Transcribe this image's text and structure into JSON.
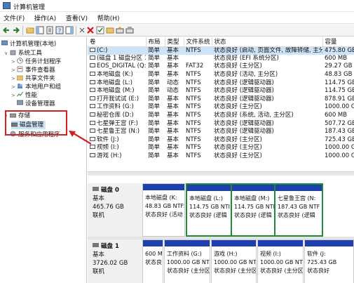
{
  "window": {
    "title": "计算机管理"
  },
  "menu": [
    "文件(F)",
    "操作(A)",
    "查看(V)",
    "帮助(H)"
  ],
  "tree": {
    "root": "计算机管理(本地)",
    "system_tools": "系统工具",
    "task_scheduler": "任务计划程序",
    "event_viewer": "事件查看器",
    "shared_folders": "共享文件夹",
    "local_users": "本地用户和组",
    "performance": "性能",
    "device_manager": "设备管理器",
    "storage": "存储",
    "disk_management": "磁盘管理",
    "services": "服务和应用程序"
  },
  "table": {
    "columns": [
      "卷",
      "布局",
      "类型",
      "文件系统",
      "状态",
      "容量"
    ],
    "rows": [
      [
        "(C:)",
        "简单",
        "基本",
        "NTFS",
        "状态良好 (启动, 页面文件, 故障转储, 主分区)",
        "475.80 GB"
      ],
      [
        "(磁盘 1 磁盘分区 1)",
        "简单",
        "基本",
        "",
        "状态良好 (EFI 系统分区)",
        "600 MB"
      ],
      [
        "EOS_DIGITAL (Q:)",
        "简单",
        "基本",
        "FAT32",
        "状态良好 (主分区)",
        "29.27 GB"
      ],
      [
        "本地磁盘 (K:)",
        "简单",
        "基本",
        "NTFS",
        "状态良好 (活动, 主分区)",
        "48.83 GB"
      ],
      [
        "本地磁盘 (L:)",
        "简单",
        "动态",
        "NTFS",
        "状态良好 (逻辑驱动器)",
        "114.75 GB"
      ],
      [
        "本地磁盘 (M:)",
        "简单",
        "动态",
        "NTFS",
        "状态良好 (逻辑驱动器)",
        "114.75 GB"
      ],
      [
        "打开我试试 (E:)",
        "简单",
        "基本",
        "NTFS",
        "状态良好 (逻辑驱动器)",
        "878.91 GB"
      ],
      [
        "工作资料 (G:)",
        "简单",
        "基本",
        "NTFS",
        "状态良好 (主分区)",
        "1000.00 GB"
      ],
      [
        "秘密仓库 (D:)",
        "简单",
        "基本",
        "NTFS",
        "状态良好 (系统, 活动, 主分区)",
        "600 MB"
      ],
      [
        "七星弹王宫 (F:)",
        "简单",
        "基本",
        "NTFS",
        "状态良好 (逻辑驱动器)",
        "507.72 GB"
      ],
      [
        "七星鲁王宫 (N:)",
        "简单",
        "基本",
        "NTFS",
        "状态良好 (逻辑驱动器)",
        "187.43 GB"
      ],
      [
        "软件 (J:)",
        "简单",
        "基本",
        "NTFS",
        "状态良好 (主分区)",
        "725.43 GB"
      ],
      [
        "视频 (I:)",
        "简单",
        "基本",
        "NTFS",
        "状态良好 (主分区)",
        "1000.00 GB"
      ],
      [
        "游戏 (H:)",
        "简单",
        "基本",
        "NTFS",
        "状态良好 (主分区)",
        "1000.00 GB"
      ]
    ]
  },
  "disk0": {
    "name": "磁盘 0",
    "type": "基本",
    "size": "465.76 GB",
    "status": "联机",
    "partitions": [
      {
        "name": "本地磁盘 (K:",
        "size": "48.83 GB NTFS",
        "status": "状态良好 (活动"
      },
      {
        "name": "本地磁盘 (L:)",
        "size": "114.75 GB NTI",
        "status": "状态良好 (逻辑"
      },
      {
        "name": "本地磁盘 (M:)",
        "size": "114.75 GB NTI",
        "status": "状态良好 (逻辑"
      },
      {
        "name": "七星鲁王宫 (N:",
        "size": "187.43 GB NTF",
        "status": "状态良好 (逻辑"
      }
    ]
  },
  "disk1": {
    "name": "磁盘 1",
    "type": "基本",
    "size": "3726.02 GB",
    "status": "联机",
    "partitions": [
      {
        "name": "",
        "size": "600 M",
        "status": "状态良"
      },
      {
        "name": "工作资料 (G:)",
        "size": "1000.00 GB NTFS",
        "status": "状态良好 (主分区"
      },
      {
        "name": "游戏 (H:)",
        "size": "1000.00 GB NTFS",
        "status": "状态良好 (主分区"
      },
      {
        "name": "视频 (I:)",
        "size": "1000.00 GB NTFS",
        "status": "状态良好 (主分区"
      },
      {
        "name": "软件 (J:",
        "size": "725.43 GB",
        "status": "状态良好"
      }
    ]
  },
  "colors": {
    "partition_bar": "#1e3fae",
    "highlight_border": "#1f8a3a",
    "annotation": "#d32020"
  }
}
